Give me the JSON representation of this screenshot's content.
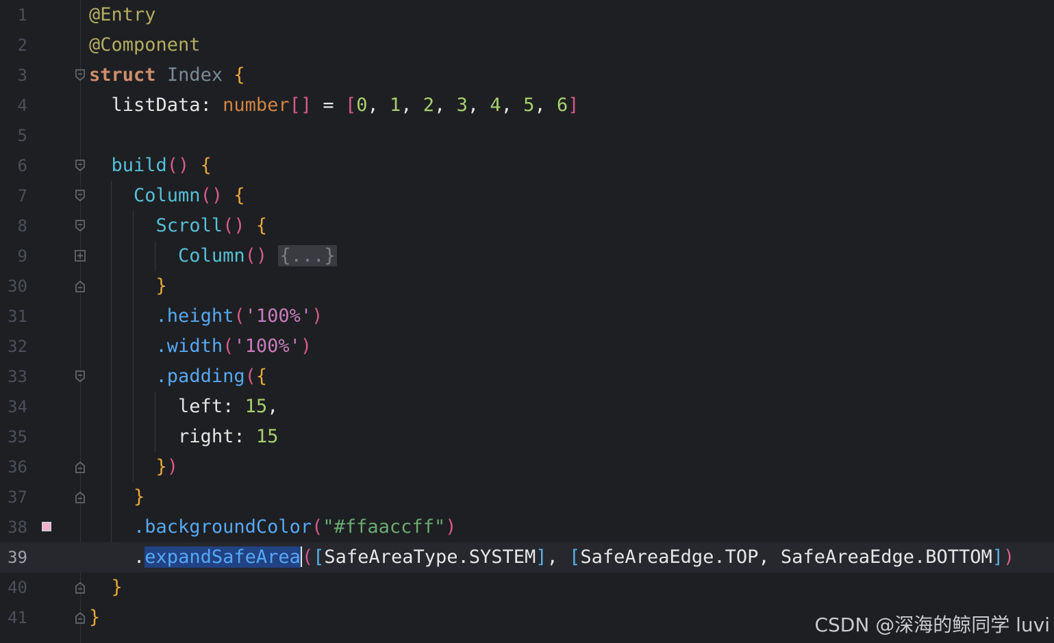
{
  "editor": {
    "lines": [
      {
        "n": "1"
      },
      {
        "n": "2"
      },
      {
        "n": "3"
      },
      {
        "n": "4"
      },
      {
        "n": "5"
      },
      {
        "n": "6"
      },
      {
        "n": "7"
      },
      {
        "n": "8"
      },
      {
        "n": "9"
      },
      {
        "n": "30"
      },
      {
        "n": "31"
      },
      {
        "n": "32"
      },
      {
        "n": "33"
      },
      {
        "n": "34"
      },
      {
        "n": "35"
      },
      {
        "n": "36"
      },
      {
        "n": "37"
      },
      {
        "n": "38"
      },
      {
        "n": "39"
      },
      {
        "n": "40"
      },
      {
        "n": "41"
      }
    ],
    "code": {
      "l1": "@Entry",
      "l2": "@Component",
      "l3_kw": "struct",
      "l3_name": "Index",
      "l4_field": "listData",
      "l4_type": "number",
      "l4_values": [
        "0",
        "1",
        "2",
        "3",
        "4",
        "5",
        "6"
      ],
      "l6_fn": "build",
      "l7_fn": "Column",
      "l8_fn": "Scroll",
      "l9_fn": "Column",
      "l9_folded": "{...}",
      "l31_fn": ".height",
      "l31_arg": "'100%'",
      "l32_fn": ".width",
      "l32_arg": "'100%'",
      "l33_fn": ".padding",
      "l34_key": "left",
      "l34_val": "15",
      "l35_key": "right",
      "l35_val": "15",
      "l38_fn": ".backgroundColor",
      "l38_arg": "\"#ffaaccff\"",
      "l39_dot": ".",
      "l39_fn": "expandSafeArea",
      "l39_a1": "SafeAreaType.SYSTEM",
      "l39_a2": "SafeAreaEdge.TOP",
      "l39_a3": "SafeAreaEdge.BOTTOM"
    },
    "bookmark_color": "#ffaacc"
  },
  "watermark": "CSDN @深海的鲸同学 luvi"
}
